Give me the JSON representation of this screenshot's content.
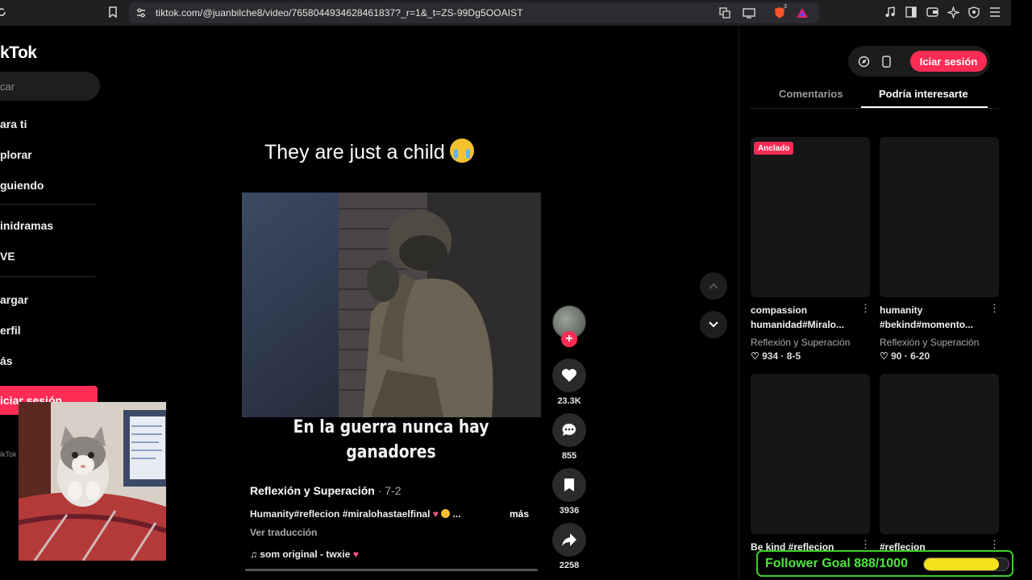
{
  "browser": {
    "url": "tiktok.com/@juanbilche8/video/7658044934628461837?_r=1&_t=ZS-99Dg5OOAIST",
    "badge_count": "3"
  },
  "sidebar": {
    "logo": "kTok",
    "search_placeholder": "car",
    "items": [
      {
        "label": "ara ti"
      },
      {
        "label": "plorar"
      },
      {
        "label": "guiendo"
      },
      {
        "label": "inidramas"
      },
      {
        "label": "VE"
      },
      {
        "label": "argar"
      },
      {
        "label": "erfil"
      },
      {
        "label": "ás"
      }
    ],
    "login_label": "iciar sesión",
    "footer_text": "ikTok"
  },
  "video": {
    "title": "They are just a child",
    "caption_line1": "En la guerra nunca hay",
    "caption_line2": "ganadores",
    "author": "Reflexión y Superación",
    "date": " · 7-2",
    "description": "Humanity#reflecion #miralohastaelfinal",
    "description_tail": " ...",
    "more_label": "más",
    "translate_label": "Ver traducción",
    "sound": "som original - twxie",
    "progress": 0.0
  },
  "actions": {
    "likes": "23.3K",
    "comments": "855",
    "saves": "3936",
    "shares": "2258"
  },
  "right_panel": {
    "login_label": "Iciar sesión",
    "tabs": [
      {
        "label": "Comentarios",
        "active": false
      },
      {
        "label": "Podría interesarte",
        "active": true
      }
    ],
    "pinned_label": "Anclado",
    "cards": [
      {
        "title": "compassion humanidad#Miralo...",
        "author": "Reflexión y Superación",
        "likes": "934",
        "date": "8-5"
      },
      {
        "title": "humanity #bekind#momento...",
        "author": "Reflexión y Superación",
        "likes": "90",
        "date": "6-20"
      },
      {
        "title": "Be kind #reflecion",
        "author": "",
        "likes": "",
        "date": ""
      },
      {
        "title": "#reflecion",
        "author": "",
        "likes": "",
        "date": ""
      }
    ]
  },
  "overlay": {
    "goal_text": "Follower Goal 888/1000",
    "goal_current": 888,
    "goal_max": 1000
  },
  "colors": {
    "accent": "#fe2c55",
    "goal_green": "#4de83b",
    "goal_fill": "#f4e21c"
  }
}
